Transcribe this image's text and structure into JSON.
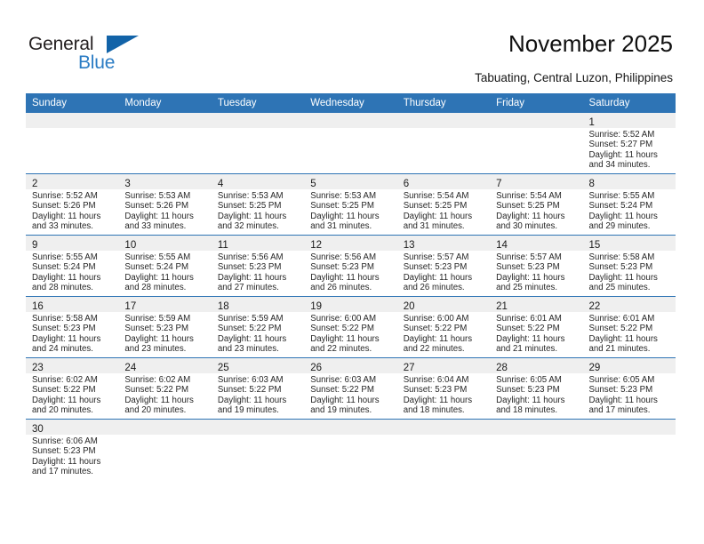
{
  "brand": {
    "name_part1": "General",
    "name_part2": "Blue",
    "triangle_icon": "triangle-icon",
    "colors": {
      "text_dark": "#231f20",
      "blue": "#2b7cc4",
      "triangle": "#1263a8"
    }
  },
  "header": {
    "title": "November 2025",
    "subtitle": "Tabuating, Central Luzon, Philippines"
  },
  "theme": {
    "header_bg": "#2e74b5",
    "header_text": "#ffffff",
    "daynum_band": "#efefef",
    "row_separator": "#2e74b5"
  },
  "weekdays": [
    "Sunday",
    "Monday",
    "Tuesday",
    "Wednesday",
    "Thursday",
    "Friday",
    "Saturday"
  ],
  "weeks": [
    [
      {
        "day": "",
        "sunrise": "",
        "sunset": "",
        "daylight1": "",
        "daylight2": ""
      },
      {
        "day": "",
        "sunrise": "",
        "sunset": "",
        "daylight1": "",
        "daylight2": ""
      },
      {
        "day": "",
        "sunrise": "",
        "sunset": "",
        "daylight1": "",
        "daylight2": ""
      },
      {
        "day": "",
        "sunrise": "",
        "sunset": "",
        "daylight1": "",
        "daylight2": ""
      },
      {
        "day": "",
        "sunrise": "",
        "sunset": "",
        "daylight1": "",
        "daylight2": ""
      },
      {
        "day": "",
        "sunrise": "",
        "sunset": "",
        "daylight1": "",
        "daylight2": ""
      },
      {
        "day": "1",
        "sunrise": "Sunrise: 5:52 AM",
        "sunset": "Sunset: 5:27 PM",
        "daylight1": "Daylight: 11 hours",
        "daylight2": "and 34 minutes."
      }
    ],
    [
      {
        "day": "2",
        "sunrise": "Sunrise: 5:52 AM",
        "sunset": "Sunset: 5:26 PM",
        "daylight1": "Daylight: 11 hours",
        "daylight2": "and 33 minutes."
      },
      {
        "day": "3",
        "sunrise": "Sunrise: 5:53 AM",
        "sunset": "Sunset: 5:26 PM",
        "daylight1": "Daylight: 11 hours",
        "daylight2": "and 33 minutes."
      },
      {
        "day": "4",
        "sunrise": "Sunrise: 5:53 AM",
        "sunset": "Sunset: 5:25 PM",
        "daylight1": "Daylight: 11 hours",
        "daylight2": "and 32 minutes."
      },
      {
        "day": "5",
        "sunrise": "Sunrise: 5:53 AM",
        "sunset": "Sunset: 5:25 PM",
        "daylight1": "Daylight: 11 hours",
        "daylight2": "and 31 minutes."
      },
      {
        "day": "6",
        "sunrise": "Sunrise: 5:54 AM",
        "sunset": "Sunset: 5:25 PM",
        "daylight1": "Daylight: 11 hours",
        "daylight2": "and 31 minutes."
      },
      {
        "day": "7",
        "sunrise": "Sunrise: 5:54 AM",
        "sunset": "Sunset: 5:25 PM",
        "daylight1": "Daylight: 11 hours",
        "daylight2": "and 30 minutes."
      },
      {
        "day": "8",
        "sunrise": "Sunrise: 5:55 AM",
        "sunset": "Sunset: 5:24 PM",
        "daylight1": "Daylight: 11 hours",
        "daylight2": "and 29 minutes."
      }
    ],
    [
      {
        "day": "9",
        "sunrise": "Sunrise: 5:55 AM",
        "sunset": "Sunset: 5:24 PM",
        "daylight1": "Daylight: 11 hours",
        "daylight2": "and 28 minutes."
      },
      {
        "day": "10",
        "sunrise": "Sunrise: 5:55 AM",
        "sunset": "Sunset: 5:24 PM",
        "daylight1": "Daylight: 11 hours",
        "daylight2": "and 28 minutes."
      },
      {
        "day": "11",
        "sunrise": "Sunrise: 5:56 AM",
        "sunset": "Sunset: 5:23 PM",
        "daylight1": "Daylight: 11 hours",
        "daylight2": "and 27 minutes."
      },
      {
        "day": "12",
        "sunrise": "Sunrise: 5:56 AM",
        "sunset": "Sunset: 5:23 PM",
        "daylight1": "Daylight: 11 hours",
        "daylight2": "and 26 minutes."
      },
      {
        "day": "13",
        "sunrise": "Sunrise: 5:57 AM",
        "sunset": "Sunset: 5:23 PM",
        "daylight1": "Daylight: 11 hours",
        "daylight2": "and 26 minutes."
      },
      {
        "day": "14",
        "sunrise": "Sunrise: 5:57 AM",
        "sunset": "Sunset: 5:23 PM",
        "daylight1": "Daylight: 11 hours",
        "daylight2": "and 25 minutes."
      },
      {
        "day": "15",
        "sunrise": "Sunrise: 5:58 AM",
        "sunset": "Sunset: 5:23 PM",
        "daylight1": "Daylight: 11 hours",
        "daylight2": "and 25 minutes."
      }
    ],
    [
      {
        "day": "16",
        "sunrise": "Sunrise: 5:58 AM",
        "sunset": "Sunset: 5:23 PM",
        "daylight1": "Daylight: 11 hours",
        "daylight2": "and 24 minutes."
      },
      {
        "day": "17",
        "sunrise": "Sunrise: 5:59 AM",
        "sunset": "Sunset: 5:23 PM",
        "daylight1": "Daylight: 11 hours",
        "daylight2": "and 23 minutes."
      },
      {
        "day": "18",
        "sunrise": "Sunrise: 5:59 AM",
        "sunset": "Sunset: 5:22 PM",
        "daylight1": "Daylight: 11 hours",
        "daylight2": "and 23 minutes."
      },
      {
        "day": "19",
        "sunrise": "Sunrise: 6:00 AM",
        "sunset": "Sunset: 5:22 PM",
        "daylight1": "Daylight: 11 hours",
        "daylight2": "and 22 minutes."
      },
      {
        "day": "20",
        "sunrise": "Sunrise: 6:00 AM",
        "sunset": "Sunset: 5:22 PM",
        "daylight1": "Daylight: 11 hours",
        "daylight2": "and 22 minutes."
      },
      {
        "day": "21",
        "sunrise": "Sunrise: 6:01 AM",
        "sunset": "Sunset: 5:22 PM",
        "daylight1": "Daylight: 11 hours",
        "daylight2": "and 21 minutes."
      },
      {
        "day": "22",
        "sunrise": "Sunrise: 6:01 AM",
        "sunset": "Sunset: 5:22 PM",
        "daylight1": "Daylight: 11 hours",
        "daylight2": "and 21 minutes."
      }
    ],
    [
      {
        "day": "23",
        "sunrise": "Sunrise: 6:02 AM",
        "sunset": "Sunset: 5:22 PM",
        "daylight1": "Daylight: 11 hours",
        "daylight2": "and 20 minutes."
      },
      {
        "day": "24",
        "sunrise": "Sunrise: 6:02 AM",
        "sunset": "Sunset: 5:22 PM",
        "daylight1": "Daylight: 11 hours",
        "daylight2": "and 20 minutes."
      },
      {
        "day": "25",
        "sunrise": "Sunrise: 6:03 AM",
        "sunset": "Sunset: 5:22 PM",
        "daylight1": "Daylight: 11 hours",
        "daylight2": "and 19 minutes."
      },
      {
        "day": "26",
        "sunrise": "Sunrise: 6:03 AM",
        "sunset": "Sunset: 5:22 PM",
        "daylight1": "Daylight: 11 hours",
        "daylight2": "and 19 minutes."
      },
      {
        "day": "27",
        "sunrise": "Sunrise: 6:04 AM",
        "sunset": "Sunset: 5:23 PM",
        "daylight1": "Daylight: 11 hours",
        "daylight2": "and 18 minutes."
      },
      {
        "day": "28",
        "sunrise": "Sunrise: 6:05 AM",
        "sunset": "Sunset: 5:23 PM",
        "daylight1": "Daylight: 11 hours",
        "daylight2": "and 18 minutes."
      },
      {
        "day": "29",
        "sunrise": "Sunrise: 6:05 AM",
        "sunset": "Sunset: 5:23 PM",
        "daylight1": "Daylight: 11 hours",
        "daylight2": "and 17 minutes."
      }
    ],
    [
      {
        "day": "30",
        "sunrise": "Sunrise: 6:06 AM",
        "sunset": "Sunset: 5:23 PM",
        "daylight1": "Daylight: 11 hours",
        "daylight2": "and 17 minutes."
      },
      {
        "day": "",
        "sunrise": "",
        "sunset": "",
        "daylight1": "",
        "daylight2": ""
      },
      {
        "day": "",
        "sunrise": "",
        "sunset": "",
        "daylight1": "",
        "daylight2": ""
      },
      {
        "day": "",
        "sunrise": "",
        "sunset": "",
        "daylight1": "",
        "daylight2": ""
      },
      {
        "day": "",
        "sunrise": "",
        "sunset": "",
        "daylight1": "",
        "daylight2": ""
      },
      {
        "day": "",
        "sunrise": "",
        "sunset": "",
        "daylight1": "",
        "daylight2": ""
      },
      {
        "day": "",
        "sunrise": "",
        "sunset": "",
        "daylight1": "",
        "daylight2": ""
      }
    ]
  ]
}
